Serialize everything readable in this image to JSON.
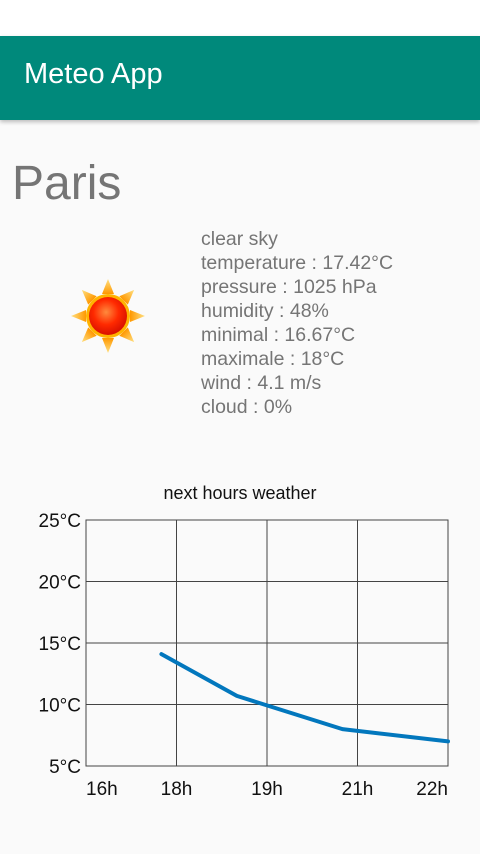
{
  "app_bar": {
    "title": "Meteo App",
    "color": "#00897b"
  },
  "weather": {
    "city": "Paris",
    "icon": "sun-icon",
    "description": "clear sky",
    "temperature": "temperature : 17.42°C",
    "pressure": "pressure : 1025 hPa",
    "humidity": "humidity : 48%",
    "minimal": "minimal : 16.67°C",
    "maximale": "maximale : 18°C",
    "wind": "wind : 4.1 m/s",
    "cloud": "cloud : 0%"
  },
  "chart_data": {
    "type": "line",
    "title": "next hours weather",
    "x_tick_labels": [
      "16h",
      "18h",
      "19h",
      "21h",
      "22h"
    ],
    "y_tick_labels": [
      "25°C",
      "20°C",
      "15°C",
      "10°C",
      "5°C"
    ],
    "y_ticks": [
      25,
      20,
      15,
      10,
      5
    ],
    "ylim": [
      5,
      25
    ],
    "xlim": [
      16.5,
      22.5
    ],
    "grid": true,
    "line_color": "#0277bd",
    "series": [
      {
        "x": [
          17.75,
          19.0,
          20.75,
          22.5
        ],
        "y": [
          14.1,
          10.7,
          8.0,
          7.0
        ]
      }
    ]
  }
}
